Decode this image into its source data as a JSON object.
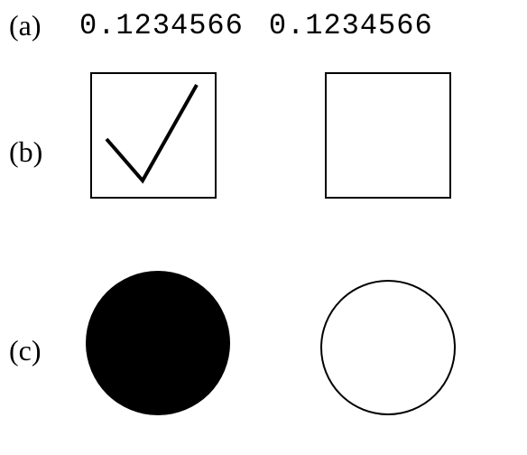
{
  "rows": {
    "a": {
      "label": "(a)",
      "value1": "0.1234566",
      "value2": "0.1234566"
    },
    "b": {
      "label": "(b)",
      "checkbox1_checked": true,
      "checkbox2_checked": false
    },
    "c": {
      "label": "(c)",
      "radio1_filled": true,
      "radio2_filled": false
    }
  }
}
